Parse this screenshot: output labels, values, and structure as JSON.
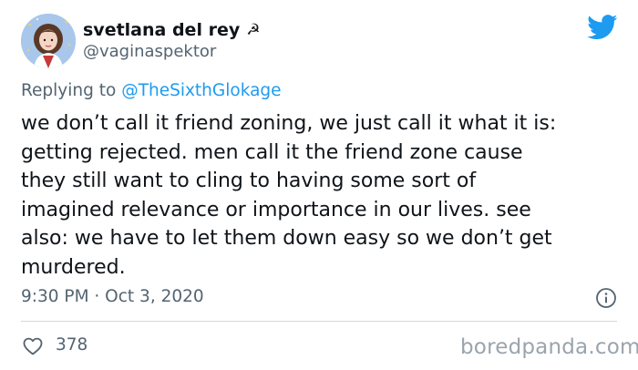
{
  "tweet": {
    "author": {
      "display_name": "svetlana del rey",
      "name_emoji": "☭",
      "handle": "@vaginaspektor"
    },
    "reply": {
      "prefix": "Replying to ",
      "handle": "@TheSixthGlokage"
    },
    "text_lines": [
      "we don’t call it friend zoning, we just call it what it is:",
      "getting rejected. men call it the friend zone cause",
      "they still want to cling to having some sort of",
      "imagined relevance or importance in our lives. see",
      "also: we have to let them down easy so we don’t get",
      "murdered."
    ],
    "timestamp": "9:30 PM · Oct 3, 2020",
    "like_count": "378"
  },
  "watermark": "boredpanda.com",
  "icons": {
    "brand": "twitter-bird-icon",
    "info": "info-icon",
    "like": "heart-icon"
  },
  "colors": {
    "twitter_blue": "#1d9bf0",
    "muted_text": "#536471",
    "primary_text": "#0f1419",
    "watermark": "#9aa4ad"
  }
}
